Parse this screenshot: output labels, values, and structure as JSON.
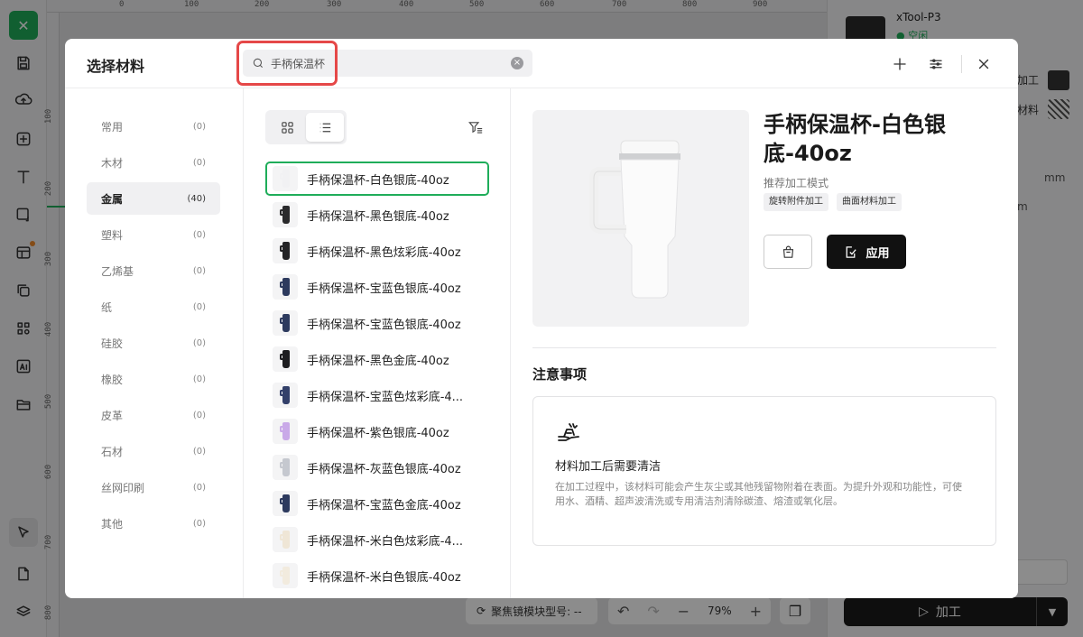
{
  "app": {
    "ruler_top_ticks": [
      "0",
      "100",
      "200",
      "300",
      "400",
      "500",
      "600",
      "700",
      "800",
      "900"
    ],
    "ruler_left_ticks": [
      "100",
      "200",
      "300",
      "400",
      "500",
      "600",
      "700",
      "800"
    ],
    "bottom": {
      "focus_label": "聚焦镜模块型号: --",
      "zoom": "79%"
    },
    "right_panel": {
      "device_name": "xTool-P3",
      "device_status": "空闲",
      "label_process": "加工",
      "label_material": "材料",
      "unit_mm": "mm",
      "unit_m": "m",
      "process_button": "加工"
    },
    "toolbar_icons": [
      "logo",
      "save-icon",
      "upload-icon",
      "add-icon",
      "text-icon",
      "shape-icon",
      "layout-icon",
      "copy-icon",
      "grid-icon",
      "ai-icon",
      "folder-icon",
      "pointer-icon",
      "file-icon",
      "layers-icon"
    ]
  },
  "modal": {
    "title": "选择材料",
    "search": {
      "value": "手柄保温杯",
      "placeholder": "手柄保温杯"
    },
    "categories": [
      {
        "label": "常用",
        "count": "(0)"
      },
      {
        "label": "木材",
        "count": "(0)"
      },
      {
        "label": "金属",
        "count": "(40)",
        "active": true
      },
      {
        "label": "塑料",
        "count": "(0)"
      },
      {
        "label": "乙烯基",
        "count": "(0)"
      },
      {
        "label": "纸",
        "count": "(0)"
      },
      {
        "label": "硅胶",
        "count": "(0)"
      },
      {
        "label": "橡胶",
        "count": "(0)"
      },
      {
        "label": "皮革",
        "count": "(0)"
      },
      {
        "label": "石材",
        "count": "(0)"
      },
      {
        "label": "丝网印刷",
        "count": "(0)"
      },
      {
        "label": "其他",
        "count": "(0)"
      }
    ],
    "materials": [
      {
        "name": "手柄保温杯-白色银底-40oz",
        "color": "#f1f1f3",
        "selected": true
      },
      {
        "name": "手柄保温杯-黑色银底-40oz",
        "color": "#2a2a2c"
      },
      {
        "name": "手柄保温杯-黑色炫彩底-40oz",
        "color": "#232325"
      },
      {
        "name": "手柄保温杯-宝蓝色银底-40oz",
        "color": "#2d3a5e"
      },
      {
        "name": "手柄保温杯-宝蓝色银底-40oz",
        "color": "#2d3a5e"
      },
      {
        "name": "手柄保温杯-黑色金底-40oz",
        "color": "#1e1e20"
      },
      {
        "name": "手柄保温杯-宝蓝色炫彩底-4...",
        "color": "#33406a"
      },
      {
        "name": "手柄保温杯-紫色银底-40oz",
        "color": "#c9a9e8"
      },
      {
        "name": "手柄保温杯-灰蓝色银底-40oz",
        "color": "#c5c8cf"
      },
      {
        "name": "手柄保温杯-宝蓝色金底-40oz",
        "color": "#2d3a5e"
      },
      {
        "name": "手柄保温杯-米白色炫彩底-4...",
        "color": "#efe6d6"
      },
      {
        "name": "手柄保温杯-米白色银底-40oz",
        "color": "#f2ebde"
      }
    ],
    "detail": {
      "title": "手柄保温杯-白色银底-40oz",
      "mode_label": "推荐加工模式",
      "tags": [
        "旋转附件加工",
        "曲面材料加工"
      ],
      "apply_label": "应用",
      "notes_title": "注意事项",
      "note_heading": "材料加工后需要清洁",
      "note_body": "在加工过程中，该材料可能会产生灰尘或其他残留物附着在表面。为提升外观和功能性，可使用水、酒精、超声波清洗或专用清洁剂清除碳渣、熔渣或氧化层。"
    }
  }
}
